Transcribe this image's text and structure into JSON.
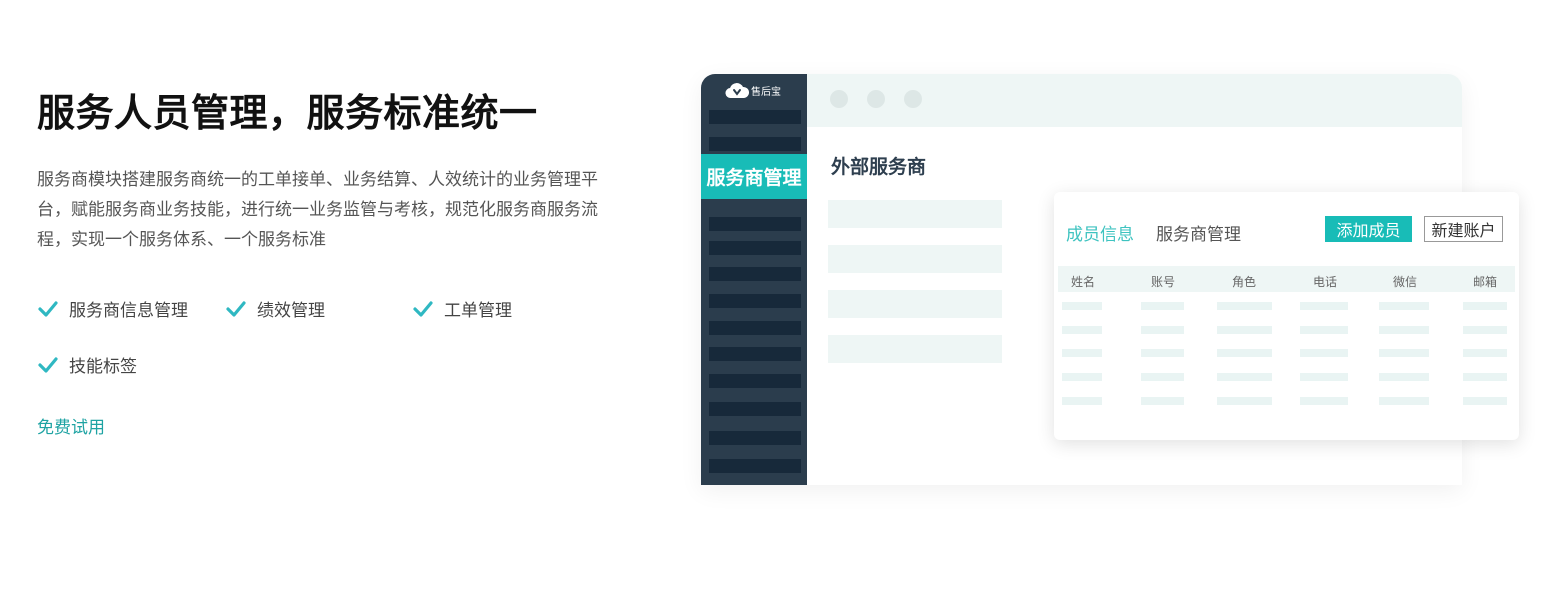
{
  "section": {
    "title": "服务人员管理，服务标准统一",
    "description": "服务商模块搭建服务商统一的工单接单、业务结算、人效统计的业务管理平台，赋能服务商业务技能，进行统一业务监管与考核，规范化服务商服务流程，实现一个服务体系、一个服务标准",
    "features": [
      "服务商信息管理",
      "绩效管理",
      "工单管理",
      "技能标签"
    ],
    "cta": "免费试用",
    "check_icon": "check-icon",
    "accent_color": "#1ea3a3"
  },
  "mockup": {
    "logo_text": "售后宝",
    "sidebar_active": "服务商管理",
    "main_title": "外部服务商",
    "card": {
      "tabs": [
        "成员信息",
        "服务商管理"
      ],
      "add_button": "添加成员",
      "new_button": "新建账户",
      "columns": [
        "姓名",
        "账号",
        "角色",
        "电话",
        "微信",
        "邮箱"
      ]
    },
    "colors": {
      "sidebar": "#2b3d4d",
      "sidebar_active": "#18bcb7",
      "topbar": "#eef6f5"
    }
  }
}
